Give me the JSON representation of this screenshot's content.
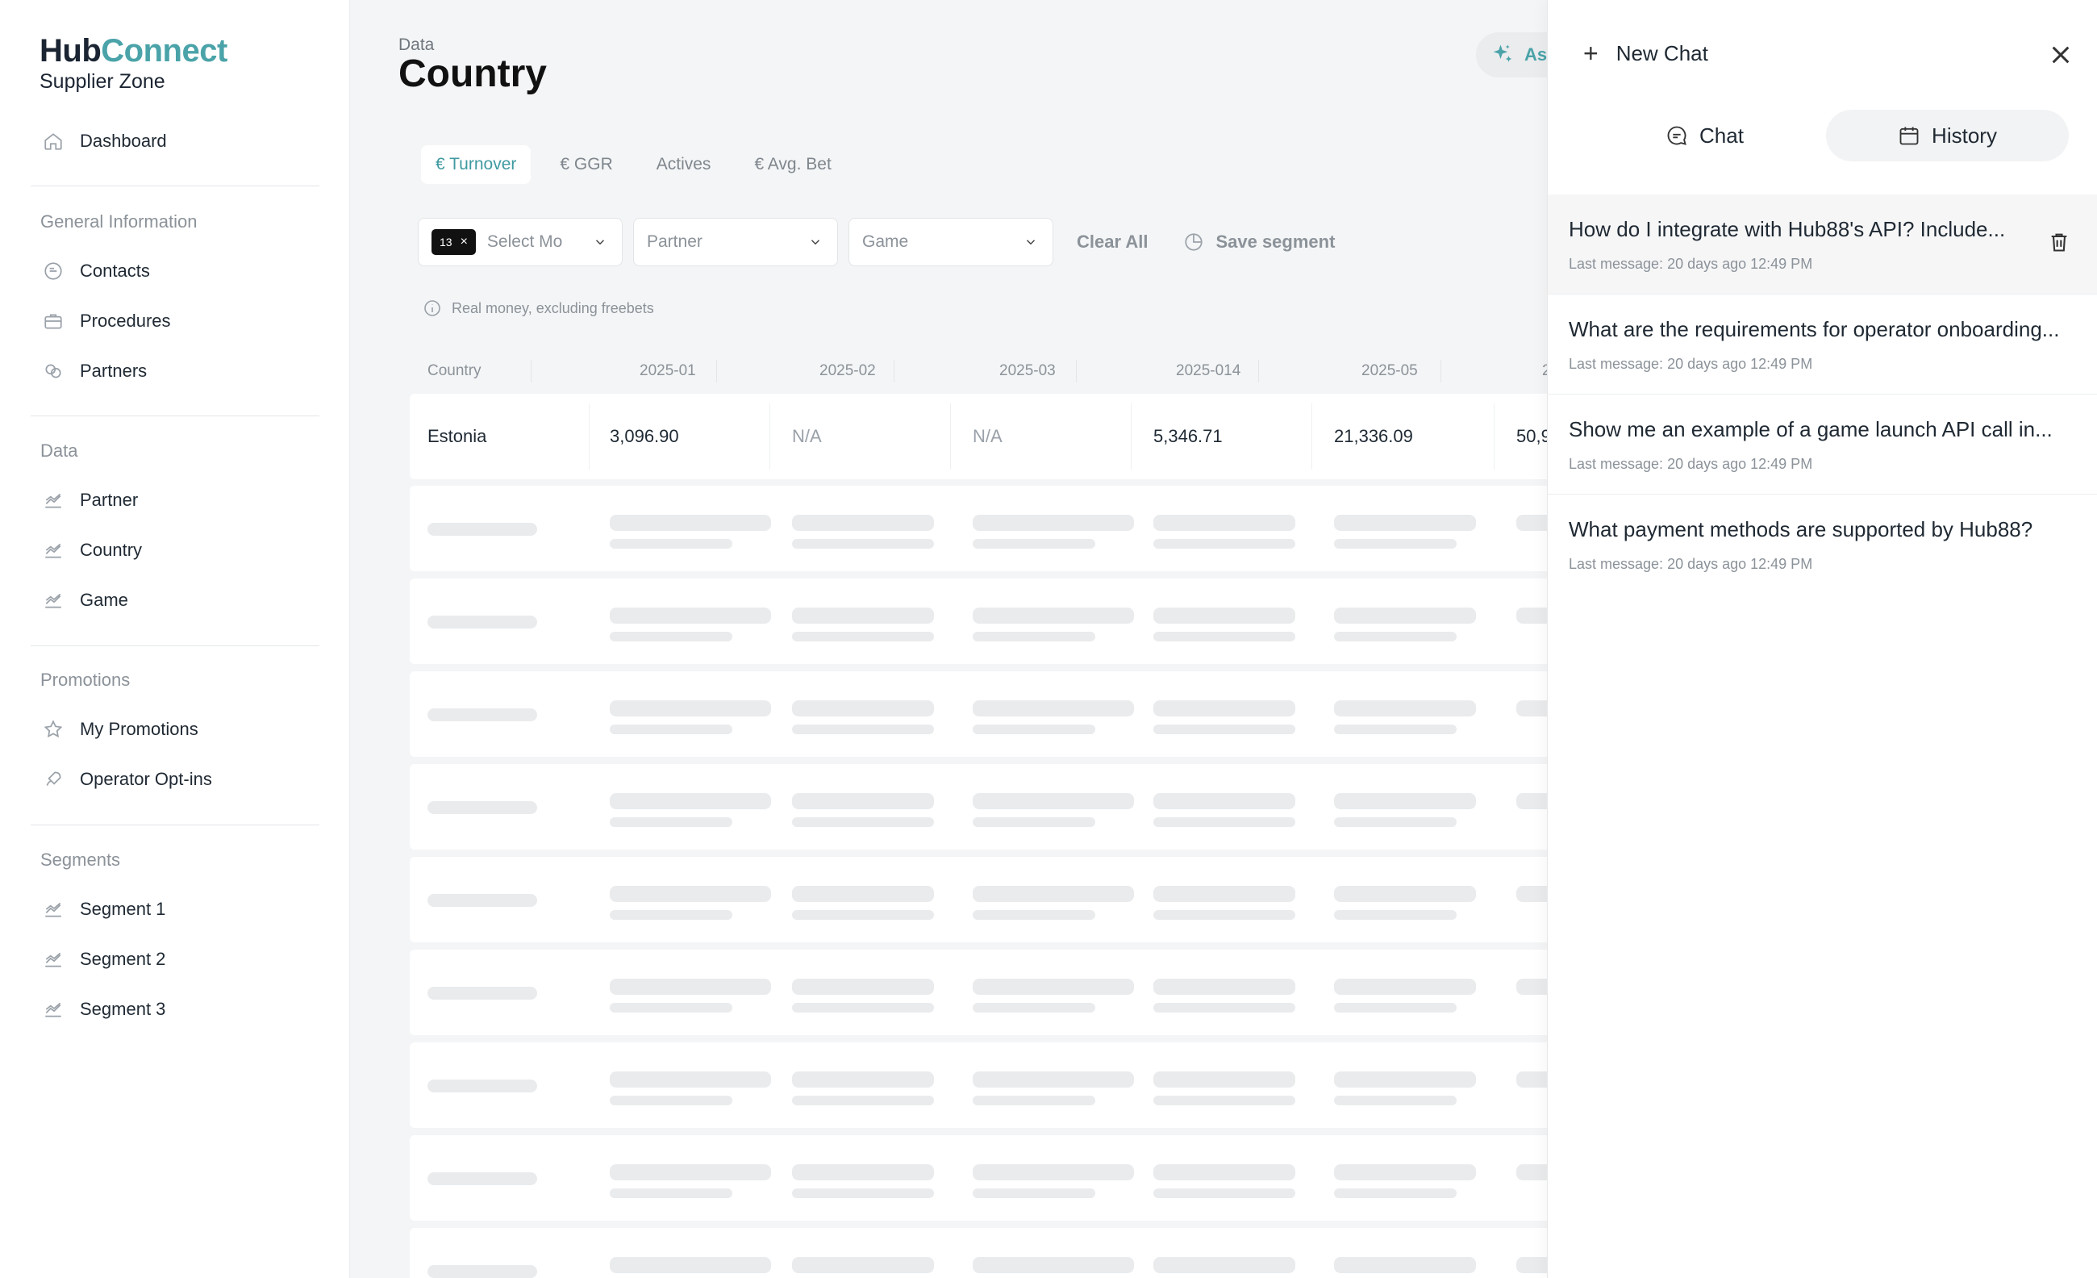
{
  "brand": {
    "hub": "Hub",
    "connect": "Connect",
    "subtitle": "Supplier Zone"
  },
  "sidebar": {
    "dashboard": "Dashboard",
    "sections": [
      {
        "title": "General Information",
        "items": [
          "Contacts",
          "Procedures",
          "Partners"
        ]
      },
      {
        "title": "Data",
        "items": [
          "Partner",
          "Country",
          "Game"
        ]
      },
      {
        "title": "Promotions",
        "items": [
          "My Promotions",
          "Operator Opt-ins"
        ]
      },
      {
        "title": "Segments",
        "items": [
          "Segment 1",
          "Segment 2",
          "Segment 3"
        ]
      }
    ]
  },
  "header": {
    "breadcrumb": "Data",
    "title": "Country",
    "ask_label": "Ask"
  },
  "metric_tabs": [
    "€ Turnover",
    "€ GGR",
    "Actives",
    "€ Avg. Bet"
  ],
  "filters": {
    "month_chip": "13",
    "month_placeholder": "Select Mo",
    "partner_placeholder": "Partner",
    "game_placeholder": "Game",
    "clear_all": "Clear All",
    "save_segment": "Save segment"
  },
  "note": "Real money, excluding freebets",
  "table": {
    "columns": [
      "Country",
      "2025-01",
      "2025-02",
      "2025-03",
      "2025-014",
      "2025-05",
      "2"
    ],
    "rows": [
      [
        "Estonia",
        "3,096.90",
        "N/A",
        "N/A",
        "5,346.71",
        "21,336.09",
        "50,9"
      ]
    ]
  },
  "chat_panel": {
    "new_chat": "New Chat",
    "tabs": [
      "Chat",
      "History"
    ],
    "active_tab": "History",
    "history": [
      {
        "title": "How do I integrate with Hub88's API? Include...",
        "meta": "Last message: 20 days ago 12:49 PM"
      },
      {
        "title": "What are the requirements for operator onboarding...",
        "meta": "Last message: 20 days ago 12:49 PM"
      },
      {
        "title": "Show me an example of a game launch API call in...",
        "meta": "Last message: 20 days ago 12:49 PM"
      },
      {
        "title": "What payment methods are supported by Hub88?",
        "meta": "Last message: 20 days ago 12:49 PM"
      }
    ]
  },
  "colors": {
    "accent": "#4aa3a8",
    "text": "#1f2933",
    "muted": "#8b9299"
  }
}
